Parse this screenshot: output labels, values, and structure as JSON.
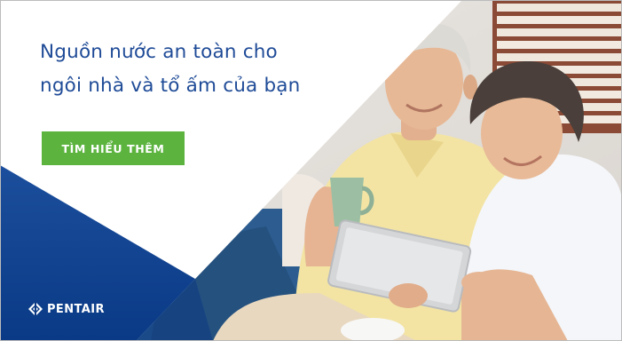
{
  "ad": {
    "headline_line1": "Nguồn nước an toàn cho",
    "headline_line2": "ngôi nhà và tổ ấm của bạn",
    "cta_label": "TÌM HIỂU THÊM",
    "logo_text": "PENTAIR"
  },
  "colors": {
    "brand_blue": "#1f4b97",
    "navy": "#0d3f8b",
    "cta_green": "#5cb43f",
    "background": "#ffffff"
  },
  "photo": {
    "alt": "Elderly couple smiling and looking at a tablet on a sofa"
  }
}
